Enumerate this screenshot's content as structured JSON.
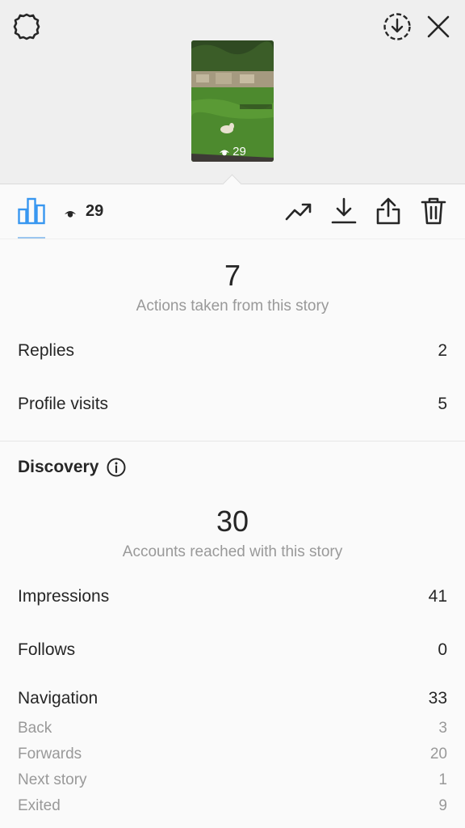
{
  "header": {
    "settings_icon": "gear-icon",
    "download_all_icon": "download-circle-icon",
    "close_icon": "close-icon"
  },
  "story": {
    "thumbnail_views": "29"
  },
  "toolbar": {
    "insights_icon": "bar-chart-icon",
    "views_count": "29",
    "actions": [
      "promote-icon",
      "download-icon",
      "share-icon",
      "delete-icon"
    ]
  },
  "interactions": {
    "total": "7",
    "label": "Actions taken from this story",
    "rows": [
      {
        "label": "Replies",
        "value": "2"
      },
      {
        "label": "Profile visits",
        "value": "5"
      }
    ]
  },
  "discovery": {
    "title": "Discovery",
    "reach": "30",
    "reach_label": "Accounts reached with this story",
    "rows": [
      {
        "label": "Impressions",
        "value": "41"
      },
      {
        "label": "Follows",
        "value": "0"
      },
      {
        "label": "Navigation",
        "value": "33"
      }
    ],
    "navigation": [
      {
        "label": "Back",
        "value": "3"
      },
      {
        "label": "Forwards",
        "value": "20"
      },
      {
        "label": "Next story",
        "value": "1"
      },
      {
        "label": "Exited",
        "value": "9"
      }
    ]
  },
  "colors": {
    "accent": "#3897f0",
    "muted": "#999999",
    "text": "#262626"
  }
}
